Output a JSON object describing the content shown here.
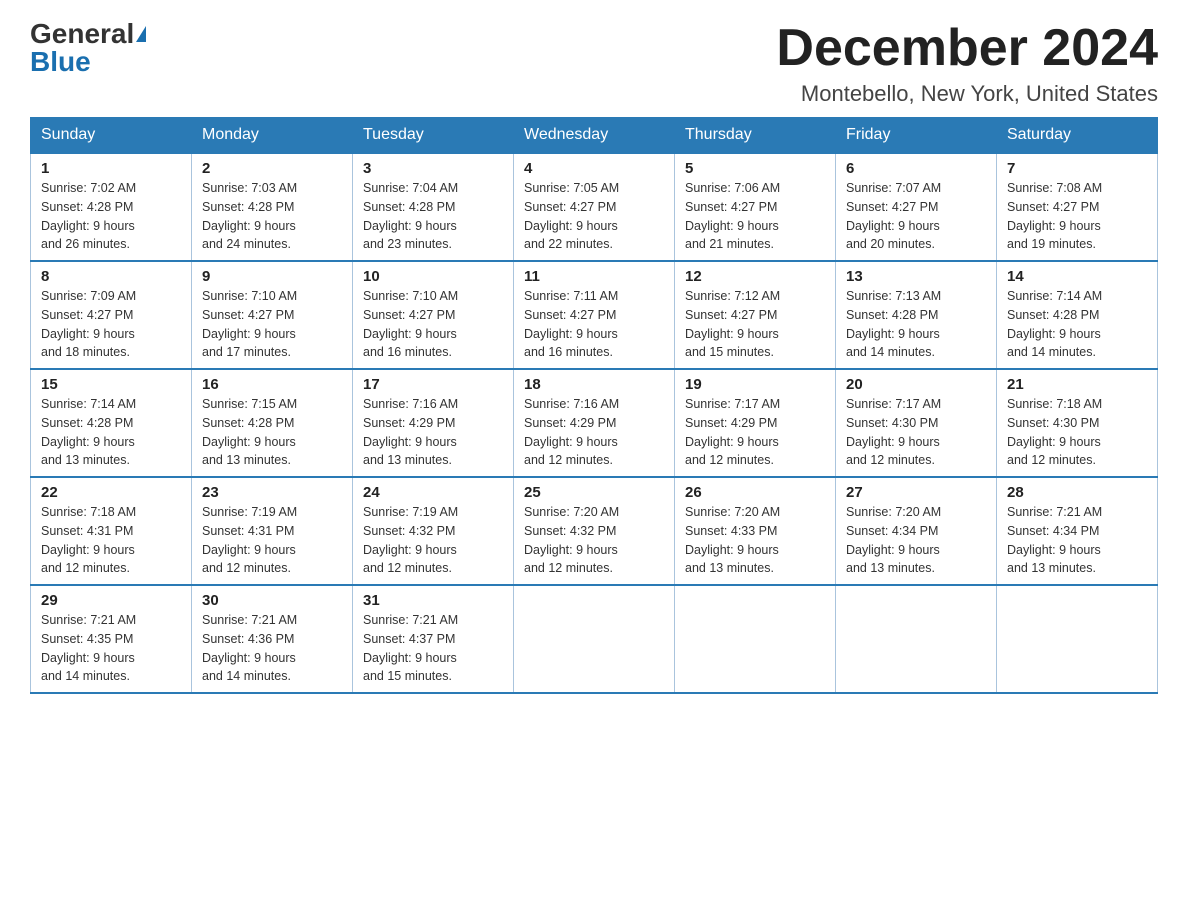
{
  "header": {
    "logo_general": "General",
    "logo_blue": "Blue",
    "month_title": "December 2024",
    "location": "Montebello, New York, United States"
  },
  "weekdays": [
    "Sunday",
    "Monday",
    "Tuesday",
    "Wednesday",
    "Thursday",
    "Friday",
    "Saturday"
  ],
  "weeks": [
    [
      {
        "day": "1",
        "sunrise": "7:02 AM",
        "sunset": "4:28 PM",
        "daylight": "9 hours and 26 minutes."
      },
      {
        "day": "2",
        "sunrise": "7:03 AM",
        "sunset": "4:28 PM",
        "daylight": "9 hours and 24 minutes."
      },
      {
        "day": "3",
        "sunrise": "7:04 AM",
        "sunset": "4:28 PM",
        "daylight": "9 hours and 23 minutes."
      },
      {
        "day": "4",
        "sunrise": "7:05 AM",
        "sunset": "4:27 PM",
        "daylight": "9 hours and 22 minutes."
      },
      {
        "day": "5",
        "sunrise": "7:06 AM",
        "sunset": "4:27 PM",
        "daylight": "9 hours and 21 minutes."
      },
      {
        "day": "6",
        "sunrise": "7:07 AM",
        "sunset": "4:27 PM",
        "daylight": "9 hours and 20 minutes."
      },
      {
        "day": "7",
        "sunrise": "7:08 AM",
        "sunset": "4:27 PM",
        "daylight": "9 hours and 19 minutes."
      }
    ],
    [
      {
        "day": "8",
        "sunrise": "7:09 AM",
        "sunset": "4:27 PM",
        "daylight": "9 hours and 18 minutes."
      },
      {
        "day": "9",
        "sunrise": "7:10 AM",
        "sunset": "4:27 PM",
        "daylight": "9 hours and 17 minutes."
      },
      {
        "day": "10",
        "sunrise": "7:10 AM",
        "sunset": "4:27 PM",
        "daylight": "9 hours and 16 minutes."
      },
      {
        "day": "11",
        "sunrise": "7:11 AM",
        "sunset": "4:27 PM",
        "daylight": "9 hours and 16 minutes."
      },
      {
        "day": "12",
        "sunrise": "7:12 AM",
        "sunset": "4:27 PM",
        "daylight": "9 hours and 15 minutes."
      },
      {
        "day": "13",
        "sunrise": "7:13 AM",
        "sunset": "4:28 PM",
        "daylight": "9 hours and 14 minutes."
      },
      {
        "day": "14",
        "sunrise": "7:14 AM",
        "sunset": "4:28 PM",
        "daylight": "9 hours and 14 minutes."
      }
    ],
    [
      {
        "day": "15",
        "sunrise": "7:14 AM",
        "sunset": "4:28 PM",
        "daylight": "9 hours and 13 minutes."
      },
      {
        "day": "16",
        "sunrise": "7:15 AM",
        "sunset": "4:28 PM",
        "daylight": "9 hours and 13 minutes."
      },
      {
        "day": "17",
        "sunrise": "7:16 AM",
        "sunset": "4:29 PM",
        "daylight": "9 hours and 13 minutes."
      },
      {
        "day": "18",
        "sunrise": "7:16 AM",
        "sunset": "4:29 PM",
        "daylight": "9 hours and 12 minutes."
      },
      {
        "day": "19",
        "sunrise": "7:17 AM",
        "sunset": "4:29 PM",
        "daylight": "9 hours and 12 minutes."
      },
      {
        "day": "20",
        "sunrise": "7:17 AM",
        "sunset": "4:30 PM",
        "daylight": "9 hours and 12 minutes."
      },
      {
        "day": "21",
        "sunrise": "7:18 AM",
        "sunset": "4:30 PM",
        "daylight": "9 hours and 12 minutes."
      }
    ],
    [
      {
        "day": "22",
        "sunrise": "7:18 AM",
        "sunset": "4:31 PM",
        "daylight": "9 hours and 12 minutes."
      },
      {
        "day": "23",
        "sunrise": "7:19 AM",
        "sunset": "4:31 PM",
        "daylight": "9 hours and 12 minutes."
      },
      {
        "day": "24",
        "sunrise": "7:19 AM",
        "sunset": "4:32 PM",
        "daylight": "9 hours and 12 minutes."
      },
      {
        "day": "25",
        "sunrise": "7:20 AM",
        "sunset": "4:32 PM",
        "daylight": "9 hours and 12 minutes."
      },
      {
        "day": "26",
        "sunrise": "7:20 AM",
        "sunset": "4:33 PM",
        "daylight": "9 hours and 13 minutes."
      },
      {
        "day": "27",
        "sunrise": "7:20 AM",
        "sunset": "4:34 PM",
        "daylight": "9 hours and 13 minutes."
      },
      {
        "day": "28",
        "sunrise": "7:21 AM",
        "sunset": "4:34 PM",
        "daylight": "9 hours and 13 minutes."
      }
    ],
    [
      {
        "day": "29",
        "sunrise": "7:21 AM",
        "sunset": "4:35 PM",
        "daylight": "9 hours and 14 minutes."
      },
      {
        "day": "30",
        "sunrise": "7:21 AM",
        "sunset": "4:36 PM",
        "daylight": "9 hours and 14 minutes."
      },
      {
        "day": "31",
        "sunrise": "7:21 AM",
        "sunset": "4:37 PM",
        "daylight": "9 hours and 15 minutes."
      },
      null,
      null,
      null,
      null
    ]
  ],
  "labels": {
    "sunrise": "Sunrise:",
    "sunset": "Sunset:",
    "daylight": "Daylight:"
  }
}
